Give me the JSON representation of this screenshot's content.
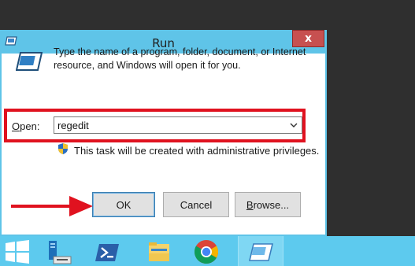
{
  "dialog": {
    "title": "Run",
    "close_label": "x",
    "description": "Type the name of a program, folder, document, or Internet resource, and Windows will open it for you.",
    "open_label_accel": "O",
    "open_label_rest": "pen:",
    "open_value": "regedit",
    "admin_note": "This task will be created with administrative privileges.",
    "ok_label": "OK",
    "cancel_label": "Cancel",
    "browse_label_accel": "B",
    "browse_label_rest": "rowse..."
  },
  "colors": {
    "frame": "#5fc4e8",
    "highlight": "#e0121f",
    "taskbar": "#5dcaee",
    "close": "#c75050"
  },
  "taskbar": {
    "icons": [
      "windows-start-icon",
      "server-manager-icon",
      "powershell-icon",
      "file-explorer-icon",
      "chrome-icon",
      "run-icon"
    ]
  }
}
